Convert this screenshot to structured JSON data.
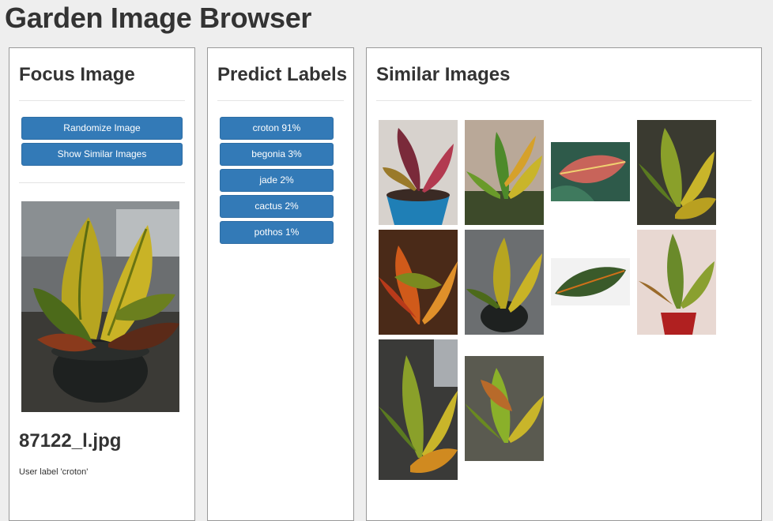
{
  "app": {
    "title": "Garden Image Browser"
  },
  "focus": {
    "heading": "Focus Image",
    "randomize_label": "Randomize Image",
    "show_similar_label": "Show Similar Images",
    "filename": "87122_l.jpg",
    "user_label": "User label 'croton'"
  },
  "predict": {
    "heading": "Predict Labels",
    "labels": [
      "croton 91%",
      "begonia 3%",
      "jade 2%",
      "cactus 2%",
      "pothos 1%"
    ]
  },
  "similar": {
    "heading": "Similar Images",
    "count": 10
  },
  "colors": {
    "accent": "#337ab7",
    "background": "#eeeeee",
    "panel": "#ffffff"
  }
}
